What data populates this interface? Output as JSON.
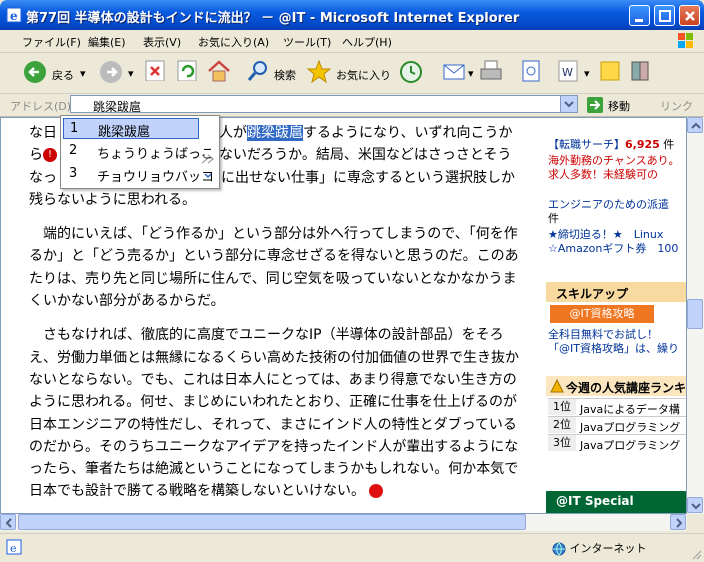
{
  "window": {
    "title": "第77回 半導体の設計もインドに流出？ － @IT - Microsoft Internet Explorer"
  },
  "menu": [
    "ファイル(F)",
    "編集(E)",
    "表示(V)",
    "お気に入り(A)",
    "ツール(T)",
    "ヘルプ(H)"
  ],
  "toolbar": {
    "back": "戻る",
    "search": "検索",
    "favorites": "お気に入り"
  },
  "address": {
    "label": "アドレス(D)",
    "value": "跳梁跋扈",
    "go": "移動",
    "links": "リンク"
  },
  "ime": {
    "candidates": [
      {
        "num": "1",
        "text": "跳梁跋扈"
      },
      {
        "num": "2",
        "text": "ちょうりょうばっこ"
      },
      {
        "num": "3",
        "text": "チョウリョウバッコ"
      }
    ]
  },
  "article": {
    "p1_l1_a": "な日",
    "p1_l1_b": "人が",
    "p1_l1_hl": "跳梁跋扈",
    "p1_l1_c": "するようになり、いずれ向こうか",
    "p1_l2_a": "ら",
    "p1_l2_b": "ないだろうか。結局、米国などはさっさとそう",
    "p1_l3_a": "なっ",
    "p1_l3_b": "に出せない仕事」に専念するという選択肢しか",
    "p1_l4": "残らないように思われる。",
    "p2": "端的にいえば、「どう作るか」という部分は外へ行ってしまうので、「何を作るか」と「どう売るか」という部分に専念せざるを得ないと思うのだ。このあたりは、売り先と同じ場所に住んで、同じ空気を吸っていないとなかなかうまくいかない部分があるからだ。",
    "p3": "さもなければ、徹底的に高度でユニークなIP（半導体の設計部品）をそろえ、労働力単価とは無縁になるくらい高めた技術の付加価値の世界で生き抜かないとならない。でも、これは日本人にとっては、あまり得意でない生き方のように思われる。何せ、まじめにいわれたとおり、正確に仕事を仕上げるのが日本エンジニアの特性だし、それって、まさにインド人の特性とダブっているのだから。そのうちユニークなアイデアを持ったインド人が輩出するようになったら、筆者たちは絶滅ということになってしまうかもしれない。何か本気で日本でも設計で勝てる戦略を構築しないといけない。"
  },
  "sidebar": {
    "job_l1": "【転職サーチ】",
    "job_count": "6,925",
    "job_unit": " 件",
    "job_l2": "海外勤務のチャンスあり。",
    "job_l3": "求人多数！未経験可の",
    "temp_l1": "エンジニアのための派遣",
    "temp_l2": "件",
    "temp_l3": "★締切迫る！★　Linux",
    "temp_l4": "☆Amazonギフト券　100",
    "skill_head": "スキルアップ",
    "skill_badge": "@IT資格攻略",
    "skill_l1": "全科目無料でお試し！",
    "skill_l2": "「@IT資格攻略」は、繰り",
    "ranking_head": "今週の人気講座ランキ",
    "ranking": [
      {
        "n": "1位",
        "t": "Javaによるデータ構"
      },
      {
        "n": "2位",
        "t": "Javaプログラミング"
      },
      {
        "n": "3位",
        "t": "Javaプログラミング"
      }
    ],
    "special": "@IT Special"
  },
  "status": {
    "zone": "インターネット"
  },
  "colors": {
    "title_bar": "#0a5be0",
    "link": "#003399",
    "accent_red": "#cc0000",
    "highlight": "#316ac5"
  }
}
